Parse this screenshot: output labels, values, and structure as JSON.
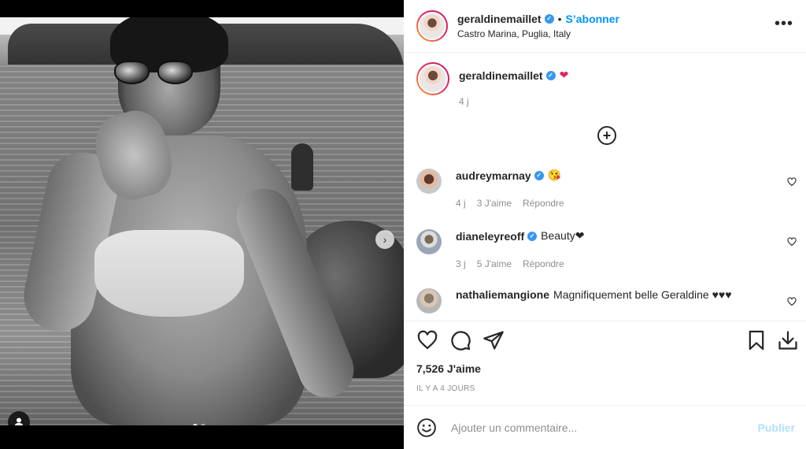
{
  "post": {
    "author": "geraldinemaillet",
    "follow_label": "S’abonner",
    "dot": "•",
    "location": "Castro Marina, Puglia, Italy",
    "more_label": "•••",
    "caption": {
      "username": "geraldinemaillet",
      "text": "❤",
      "time": "4 j"
    },
    "load_more_icon": "plus-circle-icon",
    "comments": [
      {
        "username": "audreymarnay",
        "text": "😘",
        "time": "4 j",
        "likes": "3 J'aime",
        "reply": "Répondre"
      },
      {
        "username": "dianeleyreoff",
        "text": "Beauty❤",
        "time": "3 j",
        "likes": "5 J'aime",
        "reply": "Répondre"
      },
      {
        "username": "nathaliemangione",
        "text": "Magnifiquement belle Geraldine ♥♥♥"
      }
    ],
    "likes_count": "7,526 J'aime",
    "posted_time": "IL Y A 4 JOURS",
    "comment_placeholder": "Ajouter un commentaire...",
    "publish_label": "Publier"
  },
  "carousel": {
    "next_icon": "chevron-right-icon",
    "slides": 2,
    "active_slide": 1
  },
  "colors": {
    "accent": "#0095f6",
    "verified": "#3897f0",
    "publish_disabled": "#b2dffc",
    "heart": "#e0245e"
  }
}
